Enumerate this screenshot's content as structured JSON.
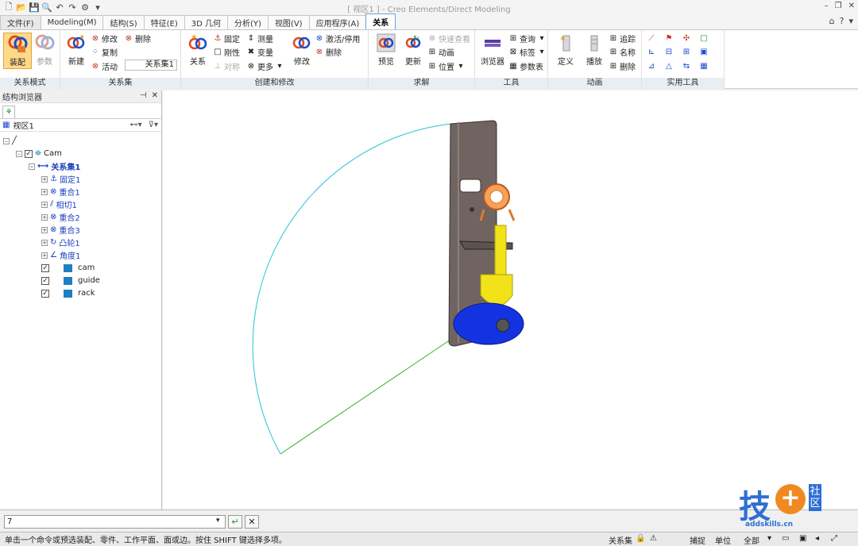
{
  "window": {
    "title": "[ 视区1 ] - Creo Elements/Direct Modeling",
    "controls": [
      "–",
      "❐",
      "✕"
    ]
  },
  "ribbon_tabs": [
    "文件(F)",
    "Modeling(M)",
    "结构(S)",
    "特征(E)",
    "3D 几何",
    "分析(Y)",
    "视图(V)",
    "应用程序(A)",
    "关系"
  ],
  "active_tab": "关系",
  "groups": {
    "mode": {
      "label": "关系模式",
      "assemble": "装配",
      "params": "参数"
    },
    "relset": {
      "label": "关系集",
      "new": "新建",
      "modify": "修改",
      "delete": "删除",
      "copy": "复制",
      "active": "活动",
      "current_set": "关系集1"
    },
    "create": {
      "label": "创建和修改",
      "relation": "关系",
      "fix": "固定",
      "measure": "测量",
      "rigid": "刚性",
      "variable": "变量",
      "symmetric": "对称",
      "more": "更多",
      "modify": "修改",
      "activate": "激活/停用",
      "delete": "删除"
    },
    "solve": {
      "label": "求解",
      "preview": "预览",
      "update": "更新",
      "quick_check": "快速查看",
      "animate": "动画",
      "position": "位置"
    },
    "tools": {
      "label": "工具",
      "browser": "浏览器",
      "query": "查询",
      "tag": "标签",
      "param_table": "参数表"
    },
    "animation": {
      "label": "动画",
      "define": "定义",
      "play": "播放",
      "track": "追踪",
      "name": "名称",
      "delete": "删除"
    },
    "utilities": {
      "label": "实用工具"
    }
  },
  "panel": {
    "title": "结构浏览器",
    "view_name": "视区1",
    "tree": {
      "root_label": "Cam",
      "relset_label": "关系集1",
      "relations": [
        "固定1",
        "重合1",
        "相切1",
        "重合2",
        "重合3",
        "凸轮1",
        "角度1"
      ],
      "parts": [
        "cam",
        "guide",
        "rack"
      ]
    }
  },
  "command": {
    "value": "7",
    "enter_icon": "↵",
    "cancel_icon": "✕"
  },
  "status": {
    "message": "单击一个命令或预选装配、零件、工作平面、面或边。按住 SHIFT 键选择多项。",
    "relset": "关系集",
    "capture": "捕捉",
    "unit": "单位",
    "filter": "全部"
  },
  "watermark": {
    "main": "技",
    "plus": "+",
    "side": "社区",
    "url": "addskills.cn"
  },
  "colors": {
    "accent": "#6a9fd4",
    "plate": "#6f6460",
    "follower": "#f2e21a",
    "cam": "#1433e0",
    "arc": "#27c4d6",
    "line": "#29b529"
  }
}
